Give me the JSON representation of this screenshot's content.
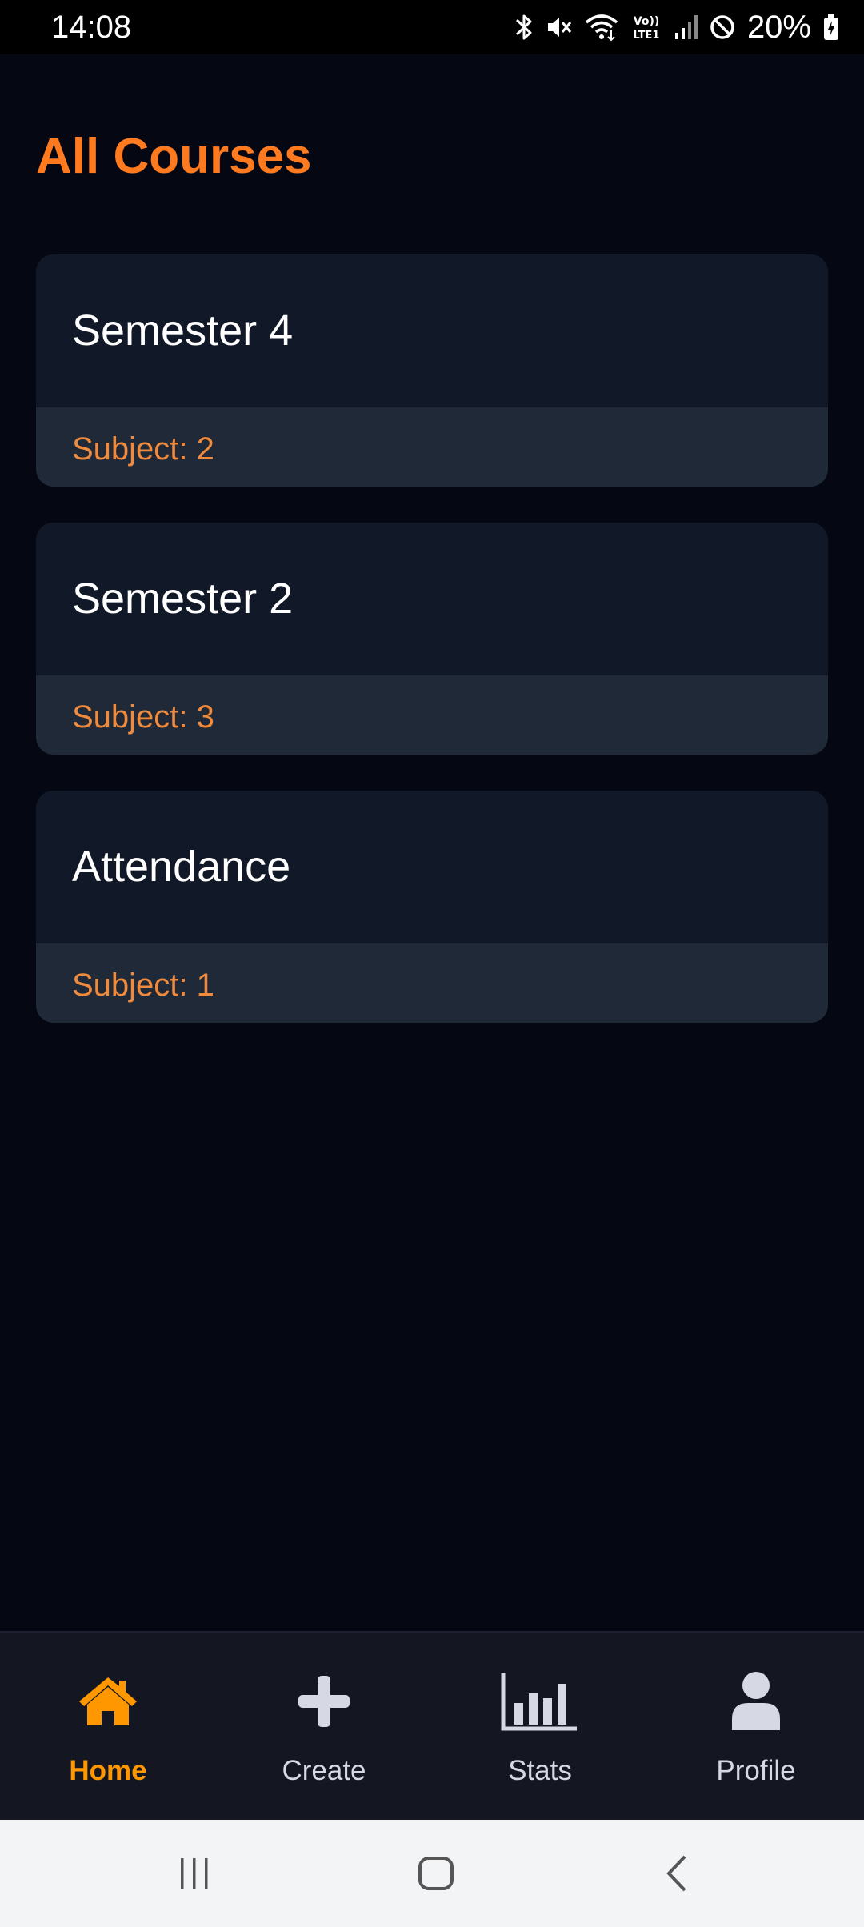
{
  "status_bar": {
    "time": "14:08",
    "battery_percent": "20%",
    "icons": [
      "bluetooth-icon",
      "mute-icon",
      "wifi-icon",
      "volte-icon",
      "signal-icon",
      "do-not-disturb-icon",
      "battery-charging-icon"
    ]
  },
  "page": {
    "title": "All Courses",
    "title_color": "#ff7a1f"
  },
  "courses": [
    {
      "name": "Semester 4",
      "subjects_label": "Subject: 2"
    },
    {
      "name": "Semester 2",
      "subjects_label": "Subject: 3"
    },
    {
      "name": "Attendance",
      "subjects_label": "Subject: 1"
    }
  ],
  "bottom_nav": {
    "active_color": "#ff9800",
    "items": [
      {
        "label": "Home",
        "icon": "home-icon",
        "active": true
      },
      {
        "label": "Create",
        "icon": "plus-icon",
        "active": false
      },
      {
        "label": "Stats",
        "icon": "bar-chart-icon",
        "active": false
      },
      {
        "label": "Profile",
        "icon": "user-icon",
        "active": false
      }
    ]
  },
  "system_nav": {
    "buttons": [
      "recent-apps-icon",
      "home-button-icon",
      "back-icon"
    ]
  }
}
